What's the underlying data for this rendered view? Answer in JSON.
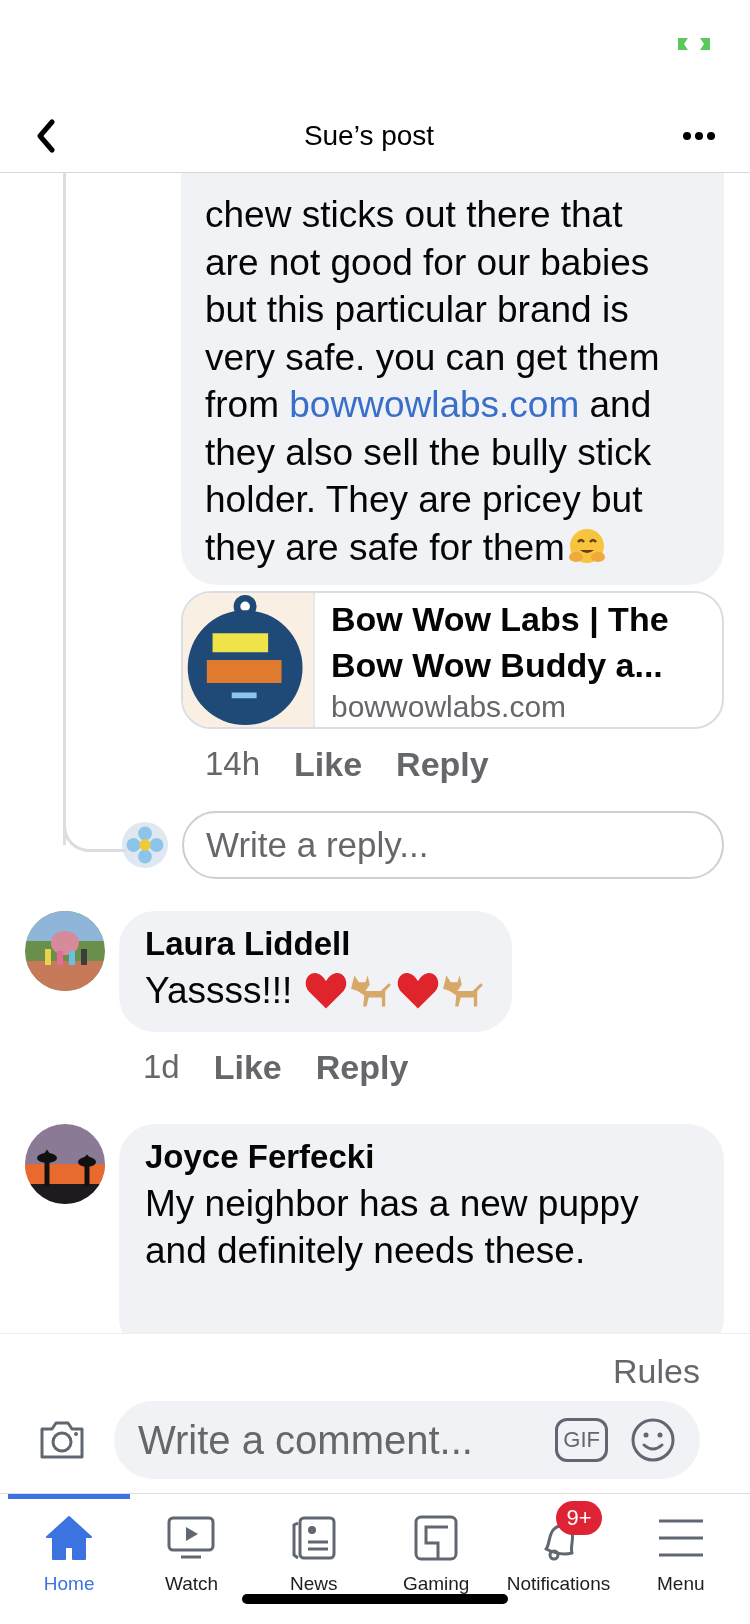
{
  "header": {
    "title": "Sue’s post"
  },
  "reply_comment": {
    "text_before_link": "chew sticks out there that are not good for our babies but this particular brand is very safe.  you can get them from ",
    "link": "bowwowlabs.com",
    "text_after_link": " and they also sell the bully stick holder. They are pricey but they are safe for them",
    "preview": {
      "title": "Bow Wow Labs | The Bow Wow Buddy a...",
      "domain": "bowwowlabs.com"
    },
    "actions": {
      "time": "14h",
      "like": "Like",
      "reply": "Reply"
    }
  },
  "reply_field": {
    "placeholder": "Write a reply..."
  },
  "comments": [
    {
      "author": "Laura Liddell",
      "text": "Yassss!!!",
      "actions": {
        "time": "1d",
        "like": "Like",
        "reply": "Reply"
      }
    },
    {
      "author": "Joyce Ferfecki",
      "text": "My neighbor has  a new puppy and definitely needs these."
    }
  ],
  "rules": "Rules",
  "composer": {
    "placeholder": "Write a comment...",
    "gif": "GIF"
  },
  "tabs": [
    {
      "label": "Home",
      "selected": true
    },
    {
      "label": "Watch",
      "selected": false
    },
    {
      "label": "News",
      "selected": false
    },
    {
      "label": "Gaming",
      "selected": false
    },
    {
      "label": "Notifications",
      "selected": false,
      "badge": "9+"
    },
    {
      "label": "Menu",
      "selected": false
    }
  ]
}
